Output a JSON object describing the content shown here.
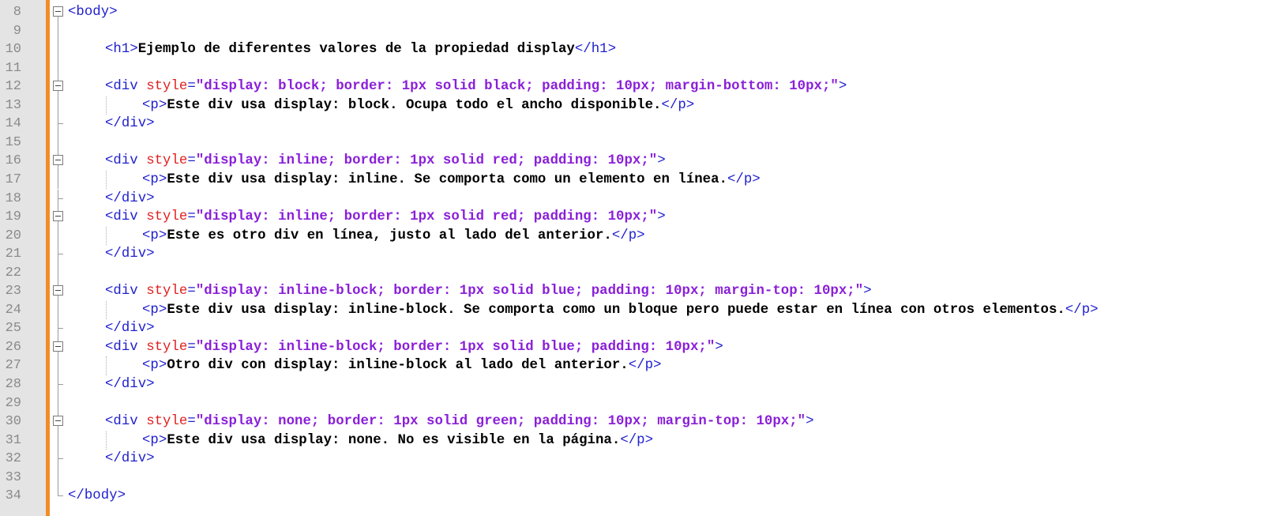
{
  "editor": {
    "colors": {
      "tag": "#1f1fcf",
      "attribute": "#e02020",
      "attribute_value": "#8a1fd8",
      "text": "#000000",
      "line_number": "#8a8a8a",
      "change_bar": "#f28c28"
    },
    "lines": [
      {
        "num": "8",
        "fold": "open-top",
        "indent": 0,
        "tokens": [
          {
            "t": "tag",
            "v": "<body>"
          }
        ]
      },
      {
        "num": "9",
        "fold": "line",
        "indent": 0,
        "tokens": []
      },
      {
        "num": "10",
        "fold": "line",
        "indent": 1,
        "tokens": [
          {
            "t": "tag",
            "v": "<h1>"
          },
          {
            "t": "txt",
            "v": "Ejemplo de diferentes valores de la propiedad display"
          },
          {
            "t": "tag",
            "v": "</h1>"
          }
        ]
      },
      {
        "num": "11",
        "fold": "line",
        "indent": 0,
        "tokens": []
      },
      {
        "num": "12",
        "fold": "open",
        "indent": 1,
        "tokens": [
          {
            "t": "tag",
            "v": "<div "
          },
          {
            "t": "attr",
            "v": "style"
          },
          {
            "t": "tag",
            "v": "="
          },
          {
            "t": "val",
            "v": "\"display: block; border: 1px solid black; padding: 10px; margin-bottom: 10px;\""
          },
          {
            "t": "tag",
            "v": ">"
          }
        ]
      },
      {
        "num": "13",
        "fold": "line",
        "indent": 2,
        "guide": true,
        "tokens": [
          {
            "t": "tag",
            "v": "<p>"
          },
          {
            "t": "txt",
            "v": "Este div usa display: block. Ocupa todo el ancho disponible."
          },
          {
            "t": "tag",
            "v": "</p>"
          }
        ]
      },
      {
        "num": "14",
        "fold": "end",
        "indent": 1,
        "tokens": [
          {
            "t": "tag",
            "v": "</div>"
          }
        ]
      },
      {
        "num": "15",
        "fold": "line",
        "indent": 0,
        "tokens": []
      },
      {
        "num": "16",
        "fold": "open",
        "indent": 1,
        "tokens": [
          {
            "t": "tag",
            "v": "<div "
          },
          {
            "t": "attr",
            "v": "style"
          },
          {
            "t": "tag",
            "v": "="
          },
          {
            "t": "val",
            "v": "\"display: inline; border: 1px solid red; padding: 10px;\""
          },
          {
            "t": "tag",
            "v": ">"
          }
        ]
      },
      {
        "num": "17",
        "fold": "line",
        "indent": 2,
        "guide": true,
        "tokens": [
          {
            "t": "tag",
            "v": "<p>"
          },
          {
            "t": "txt",
            "v": "Este div usa display: inline. Se comporta como un elemento en línea."
          },
          {
            "t": "tag",
            "v": "</p>"
          }
        ]
      },
      {
        "num": "18",
        "fold": "end",
        "indent": 1,
        "tokens": [
          {
            "t": "tag",
            "v": "</div>"
          }
        ]
      },
      {
        "num": "19",
        "fold": "open",
        "indent": 1,
        "tokens": [
          {
            "t": "tag",
            "v": "<div "
          },
          {
            "t": "attr",
            "v": "style"
          },
          {
            "t": "tag",
            "v": "="
          },
          {
            "t": "val",
            "v": "\"display: inline; border: 1px solid red; padding: 10px;\""
          },
          {
            "t": "tag",
            "v": ">"
          }
        ]
      },
      {
        "num": "20",
        "fold": "line",
        "indent": 2,
        "guide": true,
        "tokens": [
          {
            "t": "tag",
            "v": "<p>"
          },
          {
            "t": "txt",
            "v": "Este es otro div en línea, justo al lado del anterior."
          },
          {
            "t": "tag",
            "v": "</p>"
          }
        ]
      },
      {
        "num": "21",
        "fold": "end",
        "indent": 1,
        "tokens": [
          {
            "t": "tag",
            "v": "</div>"
          }
        ]
      },
      {
        "num": "22",
        "fold": "line",
        "indent": 0,
        "tokens": []
      },
      {
        "num": "23",
        "fold": "open",
        "indent": 1,
        "tokens": [
          {
            "t": "tag",
            "v": "<div "
          },
          {
            "t": "attr",
            "v": "style"
          },
          {
            "t": "tag",
            "v": "="
          },
          {
            "t": "val",
            "v": "\"display: inline-block; border: 1px solid blue; padding: 10px; margin-top: 10px;\""
          },
          {
            "t": "tag",
            "v": ">"
          }
        ]
      },
      {
        "num": "24",
        "fold": "line",
        "indent": 2,
        "guide": true,
        "tokens": [
          {
            "t": "tag",
            "v": "<p>"
          },
          {
            "t": "txt",
            "v": "Este div usa display: inline-block. Se comporta como un bloque pero puede estar en línea con otros elementos."
          },
          {
            "t": "tag",
            "v": "</p>"
          }
        ]
      },
      {
        "num": "25",
        "fold": "end",
        "indent": 1,
        "tokens": [
          {
            "t": "tag",
            "v": "</div>"
          }
        ]
      },
      {
        "num": "26",
        "fold": "open",
        "indent": 1,
        "tokens": [
          {
            "t": "tag",
            "v": "<div "
          },
          {
            "t": "attr",
            "v": "style"
          },
          {
            "t": "tag",
            "v": "="
          },
          {
            "t": "val",
            "v": "\"display: inline-block; border: 1px solid blue; padding: 10px;\""
          },
          {
            "t": "tag",
            "v": ">"
          }
        ]
      },
      {
        "num": "27",
        "fold": "line",
        "indent": 2,
        "guide": true,
        "tokens": [
          {
            "t": "tag",
            "v": "<p>"
          },
          {
            "t": "txt",
            "v": "Otro div con display: inline-block al lado del anterior."
          },
          {
            "t": "tag",
            "v": "</p>"
          }
        ]
      },
      {
        "num": "28",
        "fold": "end",
        "indent": 1,
        "tokens": [
          {
            "t": "tag",
            "v": "</div>"
          }
        ]
      },
      {
        "num": "29",
        "fold": "line",
        "indent": 0,
        "tokens": []
      },
      {
        "num": "30",
        "fold": "open",
        "indent": 1,
        "tokens": [
          {
            "t": "tag",
            "v": "<div "
          },
          {
            "t": "attr",
            "v": "style"
          },
          {
            "t": "tag",
            "v": "="
          },
          {
            "t": "val",
            "v": "\"display: none; border: 1px solid green; padding: 10px; margin-top: 10px;\""
          },
          {
            "t": "tag",
            "v": ">"
          }
        ]
      },
      {
        "num": "31",
        "fold": "line",
        "indent": 2,
        "guide": true,
        "tokens": [
          {
            "t": "tag",
            "v": "<p>"
          },
          {
            "t": "txt",
            "v": "Este div usa display: none. No es visible en la página."
          },
          {
            "t": "tag",
            "v": "</p>"
          }
        ]
      },
      {
        "num": "32",
        "fold": "end",
        "indent": 1,
        "tokens": [
          {
            "t": "tag",
            "v": "</div>"
          }
        ]
      },
      {
        "num": "33",
        "fold": "line",
        "indent": 0,
        "tokens": []
      },
      {
        "num": "34",
        "fold": "end",
        "indent": 0,
        "tokens": [
          {
            "t": "tag",
            "v": "</body>"
          }
        ]
      }
    ]
  }
}
